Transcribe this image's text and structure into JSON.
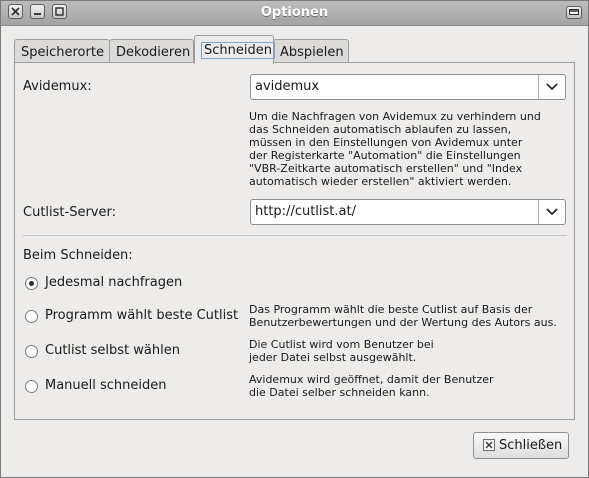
{
  "window": {
    "title": "Optionen"
  },
  "tabs": [
    {
      "label": "Speicherorte",
      "active": false
    },
    {
      "label": "Dekodieren",
      "active": false
    },
    {
      "label": "Schneiden",
      "active": true
    },
    {
      "label": "Abspielen",
      "active": false
    }
  ],
  "avidemux": {
    "label": "Avidemux:",
    "value": "avidemux",
    "description": [
      "Um die Nachfragen von Avidemux zu verhindern und",
      "das Schneiden automatisch ablaufen zu lassen,",
      "müssen in den Einstellungen von Avidemux unter",
      "der Registerkarte \"Automation\" die Einstellungen",
      "\"VBR-Zeitkarte automatisch erstellen\" und \"Index",
      "automatisch wieder erstellen\" aktiviert werden."
    ]
  },
  "cutlist_server": {
    "label": "Cutlist-Server:",
    "value": "http://cutlist.at/"
  },
  "cutting": {
    "heading": "Beim Schneiden:",
    "options": [
      {
        "label": "Jedesmal nachfragen",
        "checked": true,
        "description": []
      },
      {
        "label": "Programm wählt beste Cutlist",
        "checked": false,
        "description": [
          "Das Programm wählt die beste Cutlist auf Basis der",
          "Benutzerbewertungen und der Wertung des Autors aus."
        ]
      },
      {
        "label": "Cutlist selbst wählen",
        "checked": false,
        "description": [
          "Die Cutlist wird vom Benutzer bei",
          "jeder Datei selbst ausgewählt."
        ]
      },
      {
        "label": "Manuell schneiden",
        "checked": false,
        "description": [
          "Avidemux wird geöffnet, damit der Benutzer",
          "die Datei selber schneiden kann."
        ]
      }
    ]
  },
  "footer": {
    "close_label": "Schließen"
  },
  "icons": {
    "close": "close-icon",
    "minimize": "minimize-icon",
    "maximize": "maximize-icon",
    "dropdown": "chevron-down-icon"
  }
}
